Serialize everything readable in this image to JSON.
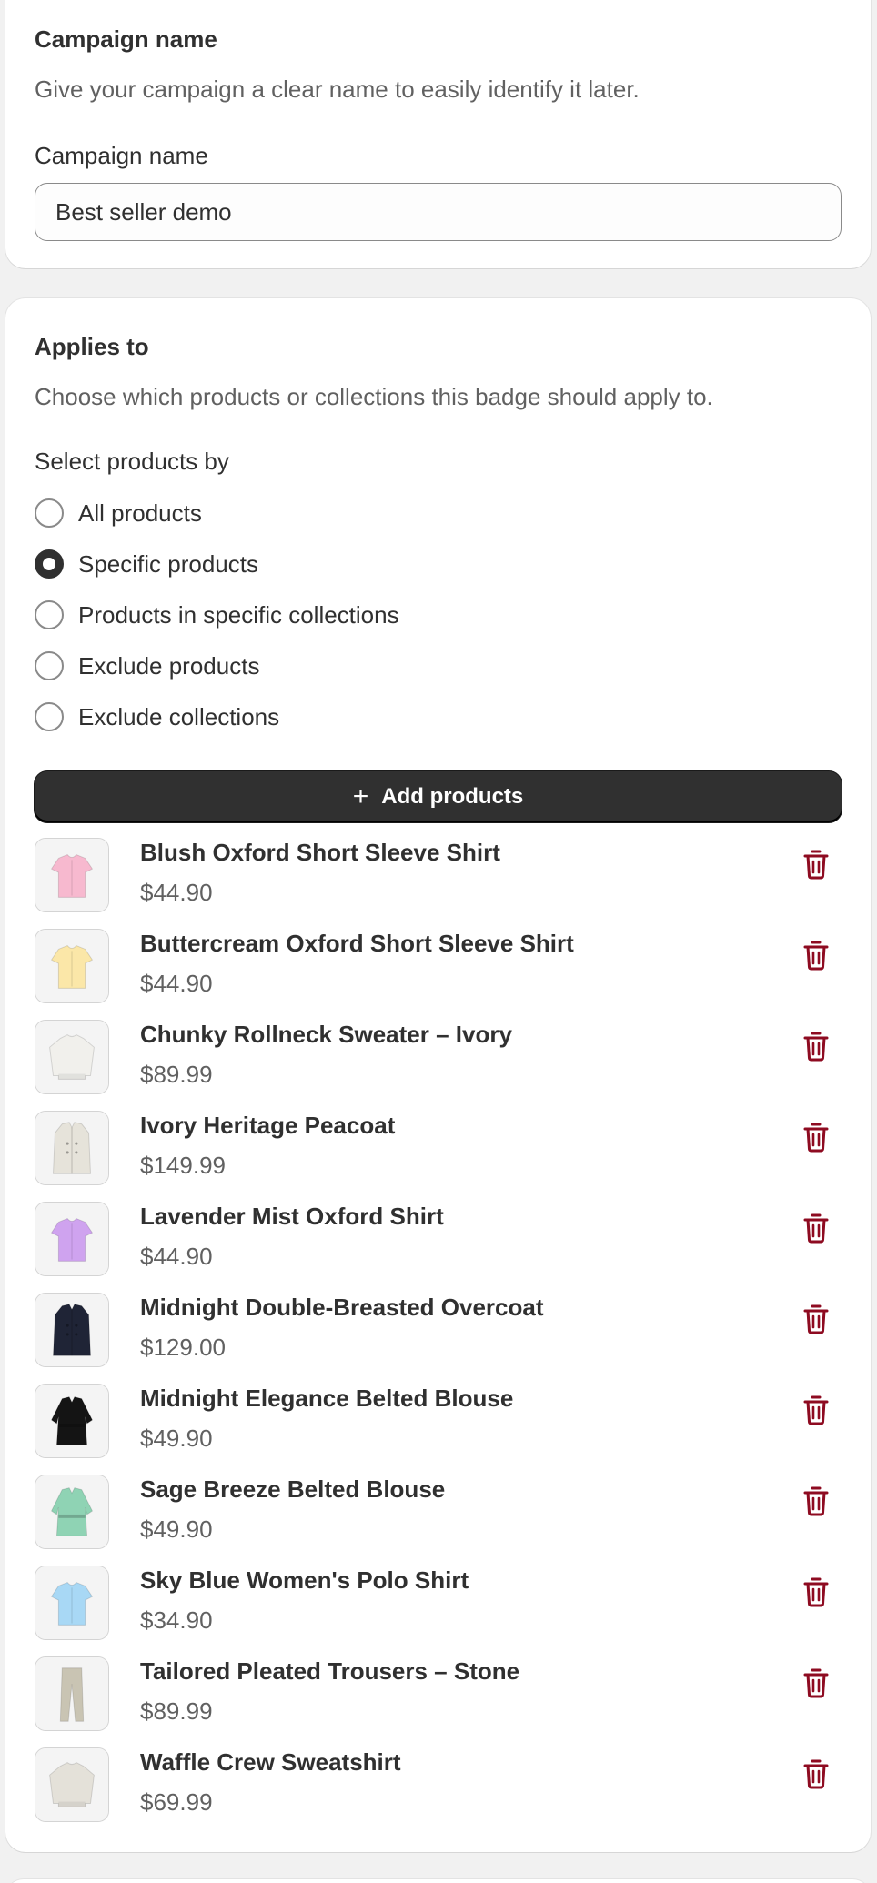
{
  "campaign": {
    "heading": "Campaign name",
    "description": "Give your campaign a clear name to easily identify it later.",
    "field_label": "Campaign name",
    "field_value": "Best seller demo"
  },
  "applies": {
    "heading": "Applies to",
    "description": "Choose which products or collections this badge should apply to.",
    "select_label": "Select products by",
    "options": [
      {
        "label": "All products",
        "checked": false
      },
      {
        "label": "Specific products",
        "checked": true
      },
      {
        "label": "Products in specific collections",
        "checked": false
      },
      {
        "label": "Exclude products",
        "checked": false
      },
      {
        "label": "Exclude collections",
        "checked": false
      }
    ],
    "add_button_label": "Add products",
    "products": [
      {
        "title": "Blush Oxford Short Sleeve Shirt",
        "price": "$44.90",
        "thumb_color": "#f7b9cf",
        "thumb_kind": "shirt"
      },
      {
        "title": "Buttercream Oxford Short Sleeve Shirt",
        "price": "$44.90",
        "thumb_color": "#fbe7a8",
        "thumb_kind": "shirt"
      },
      {
        "title": "Chunky Rollneck Sweater – Ivory",
        "price": "$89.99",
        "thumb_color": "#f1f0ec",
        "thumb_kind": "sweater"
      },
      {
        "title": "Ivory Heritage Peacoat",
        "price": "$149.99",
        "thumb_color": "#e6e3da",
        "thumb_kind": "coat"
      },
      {
        "title": "Lavender Mist Oxford Shirt",
        "price": "$44.90",
        "thumb_color": "#cfa3ef",
        "thumb_kind": "shirt"
      },
      {
        "title": "Midnight Double-Breasted Overcoat",
        "price": "$129.00",
        "thumb_color": "#1f2436",
        "thumb_kind": "coat"
      },
      {
        "title": "Midnight Elegance Belted Blouse",
        "price": "$49.90",
        "thumb_color": "#141414",
        "thumb_kind": "blouse"
      },
      {
        "title": "Sage Breeze Belted Blouse",
        "price": "$49.90",
        "thumb_color": "#8fd3b4",
        "thumb_kind": "blouse"
      },
      {
        "title": "Sky Blue Women's Polo Shirt",
        "price": "$34.90",
        "thumb_color": "#a8d8f5",
        "thumb_kind": "shirt"
      },
      {
        "title": "Tailored Pleated Trousers – Stone",
        "price": "$89.99",
        "thumb_color": "#c9c4b3",
        "thumb_kind": "trousers"
      },
      {
        "title": "Waffle Crew Sweatshirt",
        "price": "$69.99",
        "thumb_color": "#e4e1d9",
        "thumb_kind": "sweater"
      }
    ]
  },
  "colors": {
    "delete_icon": "#8e0b21",
    "primary_button": "#303030"
  },
  "icons": {
    "add": "plus-icon",
    "delete": "trash-icon"
  }
}
